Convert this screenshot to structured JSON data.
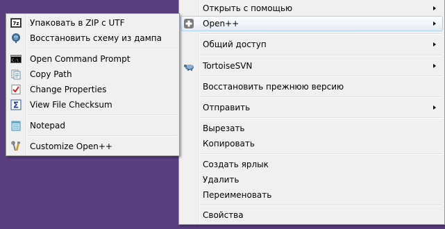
{
  "main_menu": {
    "items": [
      {
        "label": "Открыть с помощью"
      },
      {
        "label": "Open++"
      },
      {
        "label": "Общий доступ"
      },
      {
        "label": "TortoiseSVN"
      },
      {
        "label": "Восстановить прежнюю версию"
      },
      {
        "label": "Отправить"
      },
      {
        "label": "Вырезать"
      },
      {
        "label": "Копировать"
      },
      {
        "label": "Создать ярлык"
      },
      {
        "label": "Удалить"
      },
      {
        "label": "Переименовать"
      },
      {
        "label": "Свойства"
      }
    ]
  },
  "submenu": {
    "items": [
      {
        "label": "Упаковать в ZIP с UTF",
        "icon": "7zip-icon"
      },
      {
        "label": "Восстановить схему из дампа",
        "icon": "postgresql-icon"
      },
      {
        "label": "Open Command Prompt",
        "icon": "command-prompt-icon"
      },
      {
        "label": "Copy Path",
        "icon": "copy-path-icon"
      },
      {
        "label": "Change Properties",
        "icon": "checklist-icon"
      },
      {
        "label": "View File Checksum",
        "icon": "sigma-icon"
      },
      {
        "label": "Notepad",
        "icon": "notepad-icon"
      },
      {
        "label": "Customize Open++",
        "icon": "tools-icon"
      }
    ]
  },
  "colors": {
    "desktop": "#5a3f7f",
    "menu_bg": "#f0f0f0",
    "highlight_border": "#aecff7"
  }
}
